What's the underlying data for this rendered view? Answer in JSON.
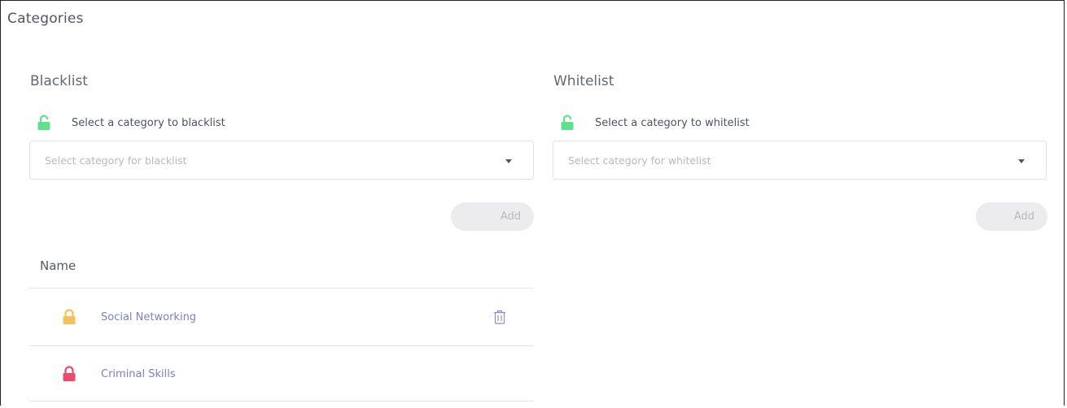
{
  "page": {
    "title": "Categories"
  },
  "blacklist": {
    "title": "Blacklist",
    "prompt": "Select a category to blacklist",
    "prompt_icon": "unlocked-padlock-icon",
    "select_placeholder": "Select category for blacklist",
    "add_label": "Add",
    "table_header": "Name",
    "rows": [
      {
        "name": "Social Networking",
        "icon": "locked-padlock-icon",
        "icon_color": "#f5c15c",
        "deletable": true
      },
      {
        "name": "Criminal Skills",
        "icon": "locked-padlock-icon",
        "icon_color": "#ee4b6b",
        "deletable": false
      }
    ]
  },
  "whitelist": {
    "title": "Whitelist",
    "prompt": "Select a category to whitelist",
    "prompt_icon": "unlocked-padlock-icon",
    "select_placeholder": "Select category for whitelist",
    "add_label": "Add"
  },
  "colors": {
    "unlock_green": "#5fe08f",
    "link": "#7b7fc3",
    "button_bg": "#ececee"
  }
}
